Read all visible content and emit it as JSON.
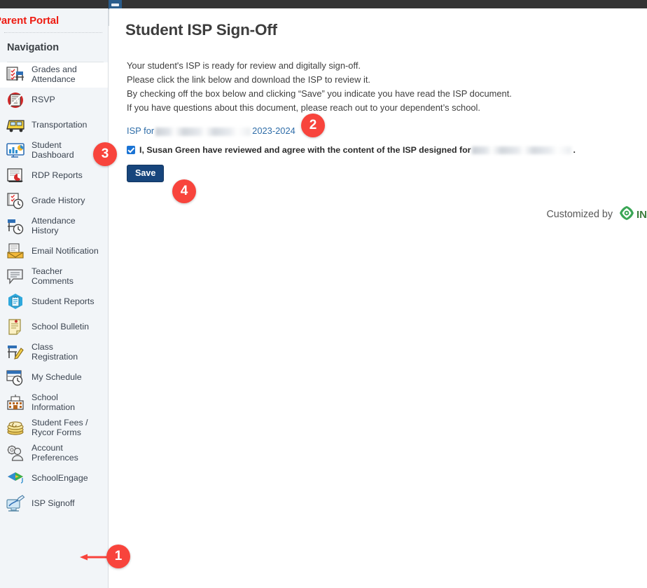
{
  "sidebar": {
    "portal_title": "Parent Portal",
    "nav_heading": "Navigation",
    "items": [
      {
        "label": "Grades and Attendance",
        "icon": "grades-attendance-icon",
        "active": true
      },
      {
        "label": "RSVP",
        "icon": "rsvp-icon",
        "active": false
      },
      {
        "label": "Transportation",
        "icon": "transportation-icon",
        "active": false
      },
      {
        "label": "Student Dashboard",
        "icon": "student-dashboard-icon",
        "active": false
      },
      {
        "label": "RDP Reports",
        "icon": "rdp-reports-icon",
        "active": false
      },
      {
        "label": "Grade History",
        "icon": "grade-history-icon",
        "active": false
      },
      {
        "label": "Attendance History",
        "icon": "attendance-history-icon",
        "active": false
      },
      {
        "label": "Email Notification",
        "icon": "email-notification-icon",
        "active": false
      },
      {
        "label": "Teacher Comments",
        "icon": "teacher-comments-icon",
        "active": false
      },
      {
        "label": "Student Reports",
        "icon": "student-reports-icon",
        "active": false
      },
      {
        "label": "School Bulletin",
        "icon": "school-bulletin-icon",
        "active": false
      },
      {
        "label": "Class Registration",
        "icon": "class-registration-icon",
        "active": false
      },
      {
        "label": "My Schedule",
        "icon": "my-schedule-icon",
        "active": false
      },
      {
        "label": "School Information",
        "icon": "school-information-icon",
        "active": false
      },
      {
        "label": "Student Fees / Rycor Forms",
        "icon": "student-fees-icon",
        "active": false
      },
      {
        "label": "Account Preferences",
        "icon": "account-preferences-icon",
        "active": false
      },
      {
        "label": "SchoolEngage",
        "icon": "schoolengage-icon",
        "active": false
      },
      {
        "label": "ISP Signoff",
        "icon": "isp-signoff-icon",
        "active": false
      }
    ]
  },
  "main": {
    "page_title": "Student ISP Sign-Off",
    "intro_lines": [
      "Your student's ISP is ready for review and digitally sign-off.",
      "Please click the link below and download the ISP to review it.",
      "By checking off the box below and clicking “Save” you indicate you have read the ISP document.",
      "If you have questions about this document, please reach out to your dependent’s school."
    ],
    "isp_link": {
      "prefix": "ISP for",
      "student_name_redacted": true,
      "school_year": "2023-2024"
    },
    "agreement": {
      "checked": true,
      "text_before": "I, Susan Green have reviewed and agree with the content of the ISP designed for",
      "text_after": "."
    },
    "save_label": "Save",
    "footer": {
      "customized_by": "Customized by",
      "brand": "IN"
    }
  },
  "annotations": [
    {
      "id": "1",
      "label": "1",
      "target": "isp-signoff-nav-item"
    },
    {
      "id": "2",
      "label": "2",
      "target": "isp-download-link"
    },
    {
      "id": "3",
      "label": "3",
      "target": "agreement-checkbox"
    },
    {
      "id": "4",
      "label": "4",
      "target": "save-button"
    }
  ],
  "colors": {
    "portal_title": "#ee1b11",
    "sidebar_bg": "#f2f5f8",
    "link": "#2f6da8",
    "save_button": "#17457c",
    "checkbox": "#1a73d4",
    "marker": "#f8443c",
    "topbar": "#333333"
  }
}
